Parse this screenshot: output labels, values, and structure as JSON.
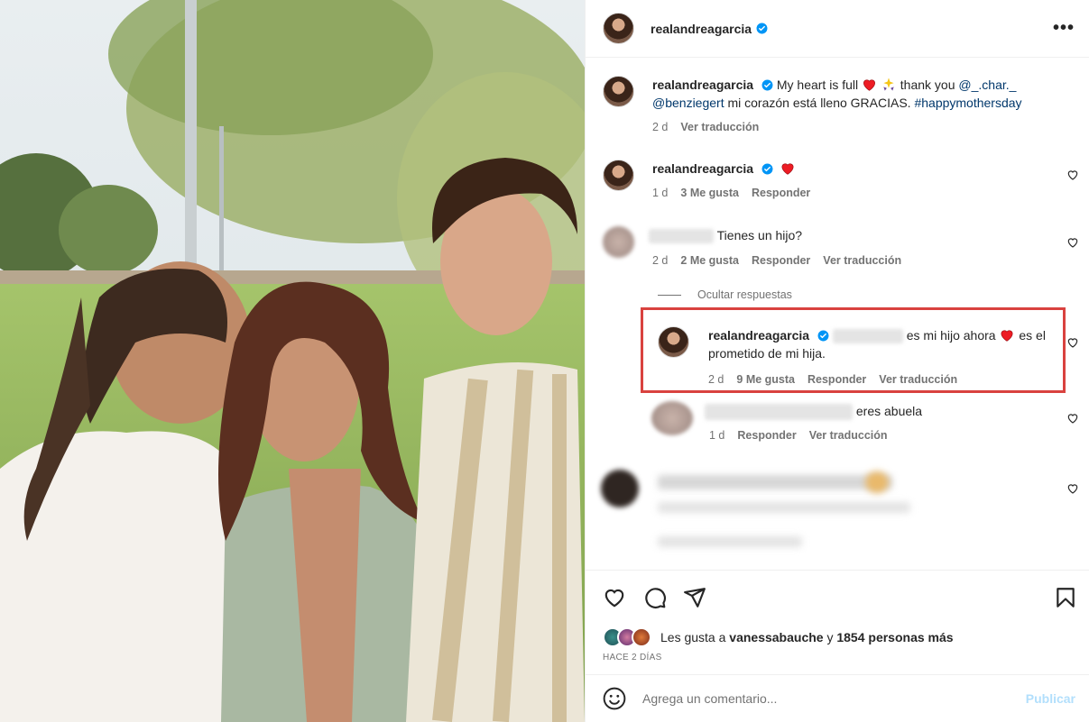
{
  "post": {
    "author": "realandreagarcia",
    "more_label": "•••"
  },
  "caption": {
    "author": "realandreagarcia",
    "text_a": "My heart is full",
    "text_b": "thank you",
    "mention_1": "@_.char._",
    "mention_2": "@benziegert",
    "text_c": "mi corazón está lleno GRACIAS.",
    "hashtag": "#happymothersday",
    "time": "2 d",
    "translate": "Ver traducción"
  },
  "comments": [
    {
      "author": "realandreagarcia",
      "time": "1 d",
      "likes": "3 Me gusta",
      "reply": "Responder"
    },
    {
      "text": "Tienes un hijo?",
      "time": "2 d",
      "likes": "2 Me gusta",
      "reply": "Responder",
      "translate": "Ver traducción"
    }
  ],
  "hide_replies": "Ocultar respuestas",
  "replies": [
    {
      "author": "realandreagarcia",
      "text_a": "es mi hijo ahora",
      "text_b": "es el prometido de mi hija.",
      "time": "2 d",
      "likes": "9 Me gusta",
      "reply": "Responder",
      "translate": "Ver traducción"
    },
    {
      "text": "eres abuela",
      "time": "1 d",
      "reply": "Responder",
      "translate": "Ver traducción"
    }
  ],
  "liked_by": {
    "prefix": "Les gusta a",
    "user": "vanessabauche",
    "conjunction": "y",
    "others": "1854 personas más"
  },
  "posted_ago": "HACE 2 DÍAS",
  "add_comment": {
    "placeholder": "Agrega un comentario...",
    "publish": "Publicar"
  },
  "colors": {
    "verified": "#0095f6",
    "heart_red": "#ed1c24",
    "highlight": "#d9423f",
    "link": "#00376b",
    "muted": "#737373"
  }
}
